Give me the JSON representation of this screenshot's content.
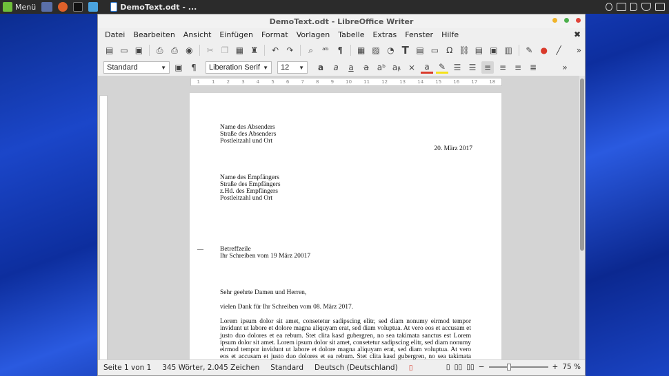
{
  "taskbar": {
    "menu_label": "Menü",
    "active_window_title": "DemoText.odt - ..."
  },
  "window": {
    "title": "DemoText.odt - LibreOffice Writer"
  },
  "menubar": {
    "items": [
      "Datei",
      "Bearbeiten",
      "Ansicht",
      "Einfügen",
      "Format",
      "Vorlagen",
      "Tabelle",
      "Extras",
      "Fenster",
      "Hilfe"
    ]
  },
  "formatting": {
    "paragraph_style": "Standard",
    "font_name": "Liberation Serif",
    "font_size": "12"
  },
  "ruler": {
    "ticks": [
      "1",
      "1",
      "2",
      "3",
      "4",
      "5",
      "6",
      "7",
      "8",
      "9",
      "10",
      "11",
      "12",
      "13",
      "14",
      "15",
      "16",
      "17",
      "18"
    ]
  },
  "document": {
    "sender": [
      "Name des Absenders",
      "Straße des Absenders",
      "Postleitzahl und Ort"
    ],
    "date": "20. März 2017",
    "recipient": [
      "Name des Empfängers",
      "Straße des Empfängers",
      "z.Hd. des Empfängers",
      "Postleitzahl und Ort"
    ],
    "subject": [
      "Betreffzeile",
      "Ihr Schreiben vom 19 März 20017"
    ],
    "salutation": "Sehr geehrte Damen und Herren,",
    "intro": "vielen Dank für Ihr Schreiben vom 08. März 2017.",
    "body": "Lorem ipsum dolor sit amet, consetetur sadipscing elitr, sed diam nonumy eirmod tempor invidunt ut labore et dolore magna aliquyam erat, sed diam voluptua. At vero eos et accusam et justo duo dolores et ea rebum. Stet clita kasd gubergren, no sea takimata sanctus est Lorem ipsum dolor sit amet. Lorem ipsum dolor sit amet, consetetur sadipscing elitr, sed diam nonumy eirmod tempor invidunt ut labore et dolore magna aliquyam erat, sed diam voluptua. At vero eos et accusam et justo duo dolores et ea rebum. Stet clita kasd gubergren, no sea takimata sanctus est Lorem ipsum"
  },
  "statusbar": {
    "page": "Seite 1 von 1",
    "words": "345 Wörter, 2.045 Zeichen",
    "page_style": "Standard",
    "language": "Deutsch (Deutschland)",
    "zoom": "75 %",
    "zoom_fraction": 0.33
  },
  "colors": {
    "accent_red": "#d93a2b",
    "highlight_yellow": "#f5e11a"
  }
}
